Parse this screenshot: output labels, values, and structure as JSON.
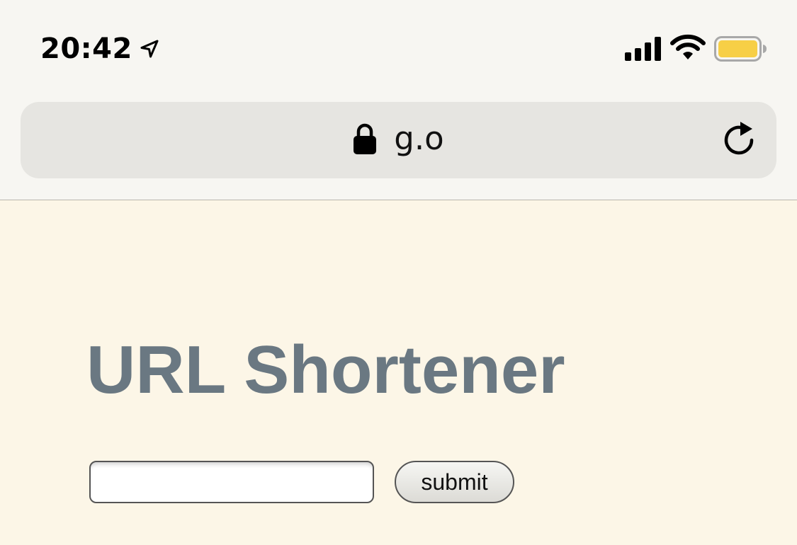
{
  "status_bar": {
    "time": "20:42",
    "icons": [
      "location-arrow-icon",
      "cellular-signal-icon",
      "wifi-icon",
      "battery-icon"
    ],
    "battery_color": "#f7cf46"
  },
  "address_bar": {
    "url": "g.o",
    "icons": [
      "lock-icon",
      "reload-icon"
    ]
  },
  "page": {
    "title": "URL Shortener",
    "title_color": "#6a7882",
    "background": "#fcf6e7",
    "url_input_value": "",
    "submit_label": "submit"
  }
}
